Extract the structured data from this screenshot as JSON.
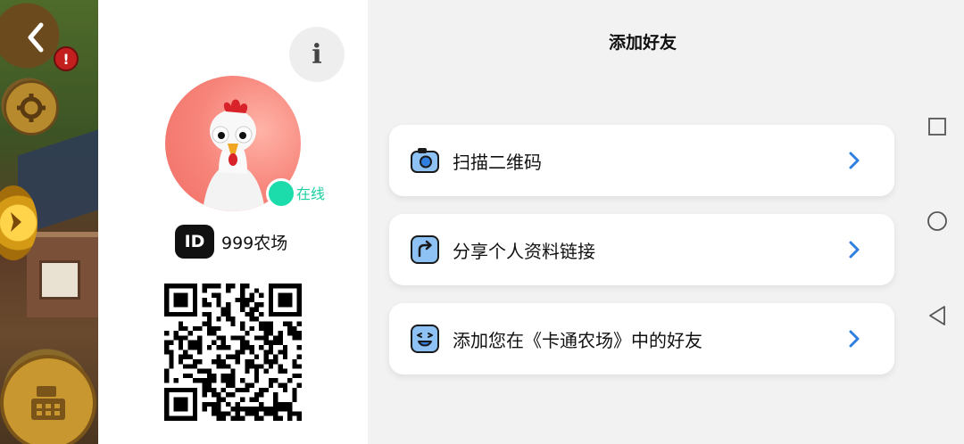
{
  "game": {
    "alert_badge": "!",
    "icons": [
      "back-arrow-icon",
      "gear-icon",
      "cash-register-icon",
      "coin-arrow-icon"
    ]
  },
  "profile": {
    "info_label": "i",
    "status": "在线",
    "id_badge": "ID",
    "username": "999农场",
    "avatar": "chicken-avatar",
    "status_color": "#1ddcac"
  },
  "header": {
    "title": "添加好友"
  },
  "options": [
    {
      "label": "扫描二维码",
      "icon": "camera-icon"
    },
    {
      "label": "分享个人资料链接",
      "icon": "share-icon"
    },
    {
      "label": "添加您在《卡通农场》中的好友",
      "icon": "smiley-icon"
    }
  ],
  "colors": {
    "accent": "#2f7fe0",
    "panel_bg": "#f2f2f2",
    "card_bg": "#ffffff"
  },
  "nav": {
    "buttons": [
      "recent-apps-icon",
      "home-icon",
      "back-icon"
    ]
  }
}
